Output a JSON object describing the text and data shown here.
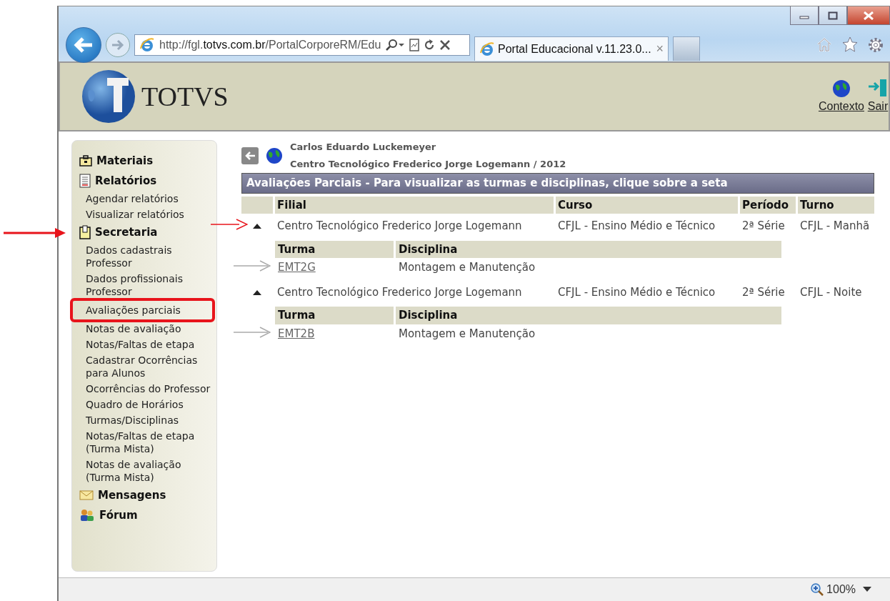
{
  "browser": {
    "url_prefix": "http://fgl.",
    "url_host": "totvs.com.br",
    "url_rest": "/PortalCorporeRM/Edu",
    "tab_title": "Portal Educacional v.11.23.0...",
    "tab_close": "×",
    "zoom": "100%"
  },
  "header": {
    "logo": "TOTVS",
    "links": [
      {
        "label": "Contexto"
      },
      {
        "label": "Sair"
      }
    ]
  },
  "sidebar": {
    "sections": [
      {
        "title": "Materiais",
        "arrow": false
      },
      {
        "title": "Relatórios",
        "arrow": false,
        "items": [
          {
            "label": "Agendar relatórios",
            "highlighted": false
          },
          {
            "label": "Visualizar relatórios",
            "highlighted": false
          }
        ]
      },
      {
        "title": "Secretaria",
        "arrow": true,
        "items": [
          {
            "label": "Dados cadastrais Professor",
            "highlighted": false
          },
          {
            "label": "Dados profissionais Professor",
            "highlighted": false
          },
          {
            "label": "Avaliações parciais",
            "highlighted": true
          },
          {
            "label": "Notas de avaliação",
            "highlighted": false
          },
          {
            "label": "Notas/Faltas de etapa",
            "highlighted": false
          },
          {
            "label": "Cadastrar Ocorrências para Alunos",
            "highlighted": false
          },
          {
            "label": "Ocorrências do Professor",
            "highlighted": false
          },
          {
            "label": "Quadro de Horários",
            "highlighted": false
          },
          {
            "label": "Turmas/Disciplinas",
            "highlighted": false
          },
          {
            "label": "Notas/Faltas de etapa (Turma Mista)",
            "highlighted": false
          },
          {
            "label": "Notas de avaliação (Turma Mista)",
            "highlighted": false
          }
        ]
      },
      {
        "title": "Mensagens",
        "arrow": false
      },
      {
        "title": "Fórum",
        "arrow": false
      }
    ]
  },
  "content": {
    "user": "Carlos Eduardo Luckemeyer",
    "school": "Centro Tecnológico Frederico Jorge Logemann / 2012",
    "title": "Avaliações Parciais - Para visualizar as turmas e disciplinas, clique sobre a seta",
    "columns": [
      "Filial",
      "Curso",
      "Período",
      "Turno"
    ],
    "groups": [
      {
        "filial": "Centro Tecnológico Frederico Jorge Logemann",
        "curso": "CFJL - Ensino Médio e Técnico",
        "periodo": "2ª Série",
        "turno": "CFJL - Manhã",
        "expanded": true,
        "arrow": true,
        "sub_columns": [
          "Turma",
          "Disciplina"
        ],
        "rows": [
          {
            "turma": "EMT2G",
            "disciplina": "Montagem e Manutenção",
            "arrow": true
          }
        ]
      },
      {
        "filial": "Centro Tecnológico Frederico Jorge Logemann",
        "curso": "CFJL - Ensino Médio e Técnico",
        "periodo": "2ª Série",
        "turno": "CFJL - Noite",
        "expanded": true,
        "arrow": false,
        "sub_columns": [
          "Turma",
          "Disciplina"
        ],
        "rows": [
          {
            "turma": "EMT2B",
            "disciplina": "Montagem e Manutenção",
            "arrow": true
          }
        ]
      }
    ]
  }
}
